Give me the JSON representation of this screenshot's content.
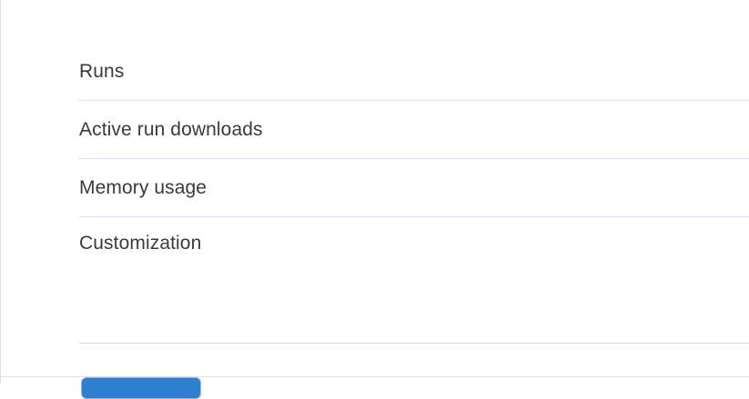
{
  "settings_menu": {
    "items": [
      {
        "label": "Runs"
      },
      {
        "label": "Active run downloads"
      },
      {
        "label": "Memory usage"
      },
      {
        "label": "Customization"
      }
    ]
  },
  "colors": {
    "divider": "#d9dbef",
    "text": "#3a3a3c",
    "button_accent": "#2f7fd1"
  }
}
